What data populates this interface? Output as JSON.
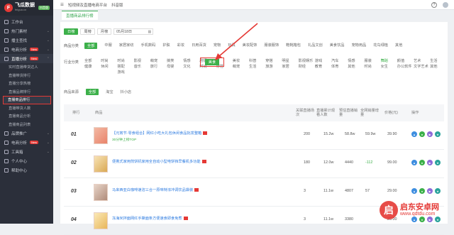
{
  "app": {
    "logo_title": "飞瓜数据",
    "logo_sub": "feigua.cn",
    "logo_badge": "抖音版"
  },
  "topbar": {
    "platform": "短视频及直播电商平台",
    "version": "抖音版"
  },
  "sidebar": {
    "items": [
      {
        "label": "工作台"
      },
      {
        "label": "热门素材"
      },
      {
        "label": "播主查找"
      },
      {
        "label": "电商分析",
        "badge": "New"
      },
      {
        "label": "直播分析",
        "badge": "New"
      }
    ],
    "sub_items": [
      {
        "label": "实时直播带货达人"
      },
      {
        "label": "直播带货排行"
      },
      {
        "label": "直播分享热榜"
      },
      {
        "label": "直播品牌排行"
      },
      {
        "label": "直播商品排行"
      },
      {
        "label": "直播带货人数"
      },
      {
        "label": "直播商品分析"
      },
      {
        "label": "直播商品列表"
      }
    ],
    "bottom_items": [
      {
        "label": "品牌推广"
      },
      {
        "label": "电商分析",
        "badge": "New"
      },
      {
        "label": "工具箱"
      },
      {
        "label": "个人中心"
      },
      {
        "label": "帮助中心"
      }
    ]
  },
  "tab": {
    "label": "直播商品排行榜"
  },
  "filters": {
    "date_buttons": [
      "日榜",
      "周榜",
      "月榜"
    ],
    "date_value": "05月18日",
    "cat_label": "商品分类",
    "cat_all": "全部",
    "cat_items": [
      "中服",
      "家居家纺",
      "手机数码",
      "护肤",
      "彩妆",
      "日用百货",
      "宠物",
      "玩具",
      "美妆配饰",
      "服装服饰",
      "鞋靴箱包",
      "礼品文创",
      "美食饮品",
      "宠物用品",
      "花鸟绿植",
      "其他"
    ],
    "industry_label": "行业分类",
    "industry_cols": [
      [
        "全部",
        "健康"
      ],
      [
        "时尚",
        "休闲"
      ],
      [
        "时尚",
        "搭配",
        "游戏"
      ],
      [
        "影视",
        "音乐"
      ],
      [
        "萌宠",
        "旅行"
      ],
      [
        "搞笑",
        "母婴"
      ],
      [
        "情感",
        "文化"
      ],
      [
        "剧情",
        "时尚"
      ],
      [
        "美食",
        "穿搭"
      ],
      [
        "美妆",
        "萌宠"
      ],
      [
        "科普",
        "生活"
      ],
      [
        "穿搭",
        "旅游"
      ],
      [
        "明星",
        "家居"
      ],
      [
        "影视娱乐",
        "财经"
      ],
      [
        "游戏",
        "教育"
      ],
      [
        "汽车",
        "体育"
      ],
      [
        "情感",
        "其他"
      ],
      [
        "服装",
        "时尚"
      ],
      [
        "舞蹈",
        "女生"
      ],
      [
        "颜值",
        "办公软件"
      ],
      [
        "艺术",
        "文字艺术"
      ],
      [
        "生活",
        "其他"
      ]
    ],
    "selected_industry": "美食",
    "source_label": "商品来源",
    "source_options": [
      "全部",
      "淘宝",
      "抖小店"
    ]
  },
  "table": {
    "headers": [
      "排行",
      "商品",
      "",
      "",
      "",
      "",
      "",
      "",
      "",
      "",
      "",
      "",
      "操作"
    ],
    "col_headers": {
      "rank": "排行",
      "goods": "商品",
      "live_count": "关联直播场次",
      "viewers": "直播累计观看人数",
      "sales": "预估直播销量",
      "growth": "全网销量增量",
      "price": "价格(元)",
      "ops": "操作"
    },
    "rows": [
      {
        "rank": "01",
        "title": "【元宵节·零食组合】网红小吃大礼包休闲食品批发整箱",
        "tag": "30分钟上榜TOP",
        "live_count": "200",
        "viewers": "15.2w",
        "sales": "58.8w",
        "growth": "59.9w",
        "price": "39.90"
      },
      {
        "rank": "02",
        "title": "便携式家用煎饼机家用全自动小型电饼铛早餐机多功能",
        "tag": "",
        "live_count": "180",
        "viewers": "12.0w",
        "sales": "4440",
        "growth": "-112",
        "price": "99.00"
      },
      {
        "rank": "03",
        "title": "马来西亚白咖啡速溶三合一原味特浓冲调饮品袋装",
        "tag": "",
        "live_count": "3",
        "viewers": "11.1w",
        "sales": "4807",
        "growth": "57",
        "price": "29.00"
      },
      {
        "rank": "04",
        "title": "冻海米拌面网红手撕面条方便速食即食免煮",
        "tag": "",
        "live_count": "3",
        "viewers": "11.1w",
        "sales": "3380",
        "growth": "",
        "price": "29.00"
      }
    ]
  },
  "watermark": {
    "cn": "启东安卓网",
    "url": "www.qdtdu.com",
    "mark": "启"
  }
}
